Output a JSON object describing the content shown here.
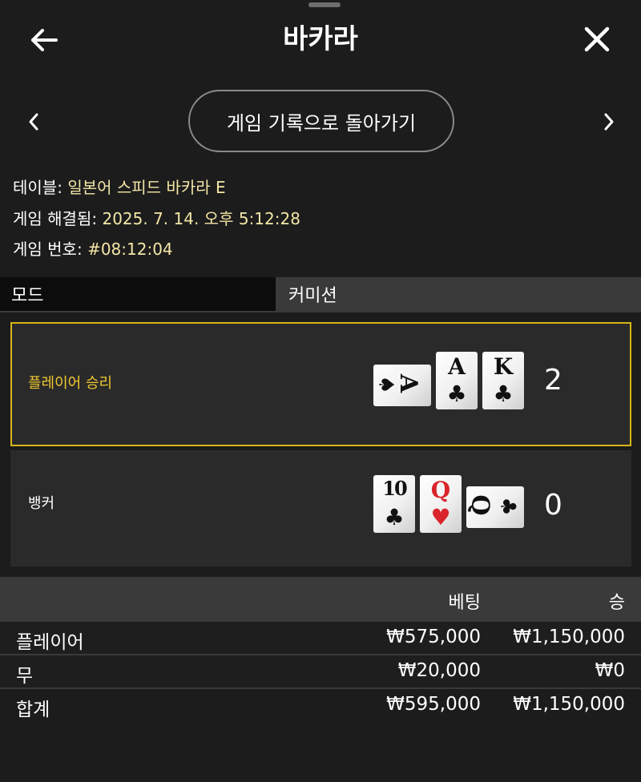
{
  "header": {
    "title": "바카라"
  },
  "nav": {
    "history_label": "게임 기록으로 돌아가기"
  },
  "info": {
    "table_label": "테이블:",
    "table_value": "일본어 스피드 바카라 E",
    "resolved_label": "게임 해결됨:",
    "resolved_value": "2025. 7. 14. 오후 5:12:28",
    "number_label": "게임 번호:",
    "number_value": "#08:12:04"
  },
  "mode": {
    "left": "모드",
    "right": "커미션"
  },
  "hands": {
    "player": {
      "label": "플레이어 승리",
      "score": "2",
      "cards": [
        {
          "rank": "A",
          "suit": "♠",
          "orientation": "sideways"
        },
        {
          "rank": "A",
          "suit": "♣",
          "orientation": "upright"
        },
        {
          "rank": "K",
          "suit": "♣",
          "orientation": "upright"
        }
      ]
    },
    "banker": {
      "label": "뱅커",
      "score": "0",
      "cards": [
        {
          "rank": "10",
          "suit": "♣",
          "orientation": "upright"
        },
        {
          "rank": "Q",
          "suit": "♥",
          "orientation": "upright",
          "color": "#d9242b"
        },
        {
          "rank": "Q",
          "suit": "♣",
          "orientation": "sideways"
        }
      ]
    }
  },
  "table": {
    "headers": {
      "bet": "베팅",
      "win": "승"
    },
    "rows": [
      {
        "name": "플레이어",
        "bet": "₩575,000",
        "win": "₩1,150,000"
      },
      {
        "name": "무",
        "bet": "₩20,000",
        "win": "₩0"
      },
      {
        "name": "합계",
        "bet": "₩595,000",
        "win": "₩1,150,000"
      }
    ]
  },
  "colors": {
    "accent": "#d8b616",
    "accent_text": "#f0c830",
    "info_value": "#f3e6a8",
    "heart_red": "#d9242b"
  },
  "icons": {
    "back": "arrow-left-icon",
    "close": "close-icon",
    "prev": "chevron-left-icon",
    "next": "chevron-right-icon"
  }
}
